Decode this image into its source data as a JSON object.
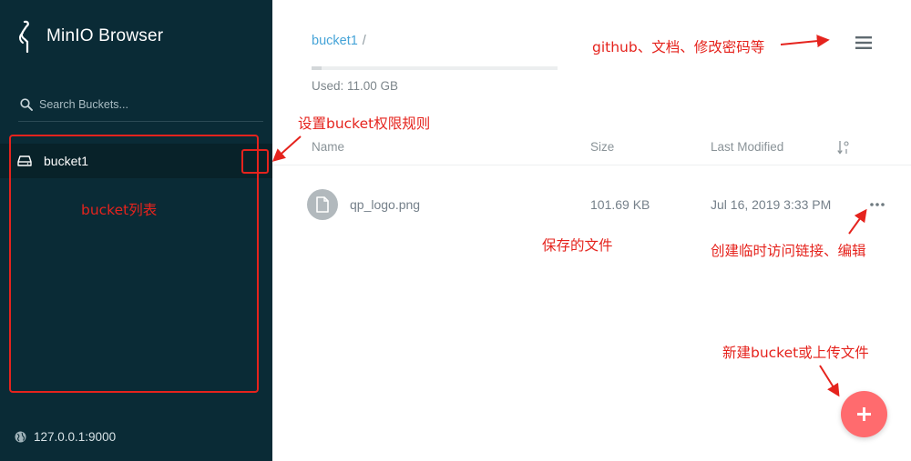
{
  "app": {
    "title": "MinIO Browser"
  },
  "sidebar": {
    "search_placeholder": "Search Buckets...",
    "buckets": [
      {
        "label": "bucket1",
        "selected": true
      }
    ],
    "server_address": "127.0.0.1:9000"
  },
  "header": {
    "breadcrumb": {
      "bucket": "bucket1",
      "separator": "/"
    },
    "storage_used": "Used: 11.00 GB"
  },
  "file_list": {
    "columns": {
      "name": "Name",
      "size": "Size",
      "modified": "Last Modified"
    },
    "rows": [
      {
        "name": "qp_logo.png",
        "size": "101.69 KB",
        "modified": "Jul 16, 2019 3:33 PM"
      }
    ]
  },
  "annotations": {
    "menu_note": "github、文档、修改密码等",
    "policy_note": "设置bucket权限规则",
    "bucket_list_note": "bucket列表",
    "saved_files_note": "保存的文件",
    "share_note": "创建临时访问链接、编辑",
    "create_note": "新建bucket或上传文件"
  },
  "colors": {
    "sidebar_bg": "#0a2b36",
    "link": "#46a4d8",
    "fab": "#ff6b6e",
    "annotation": "#e5231d"
  },
  "icons": {
    "logo": "minio-logo-icon",
    "search": "search-icon",
    "bucket": "bucket-icon",
    "server": "globe-icon",
    "menu": "hamburger-menu-icon",
    "sort": "sort-icon",
    "file": "file-icon",
    "actions": "more-dots-icon",
    "fab": "plus-icon"
  }
}
